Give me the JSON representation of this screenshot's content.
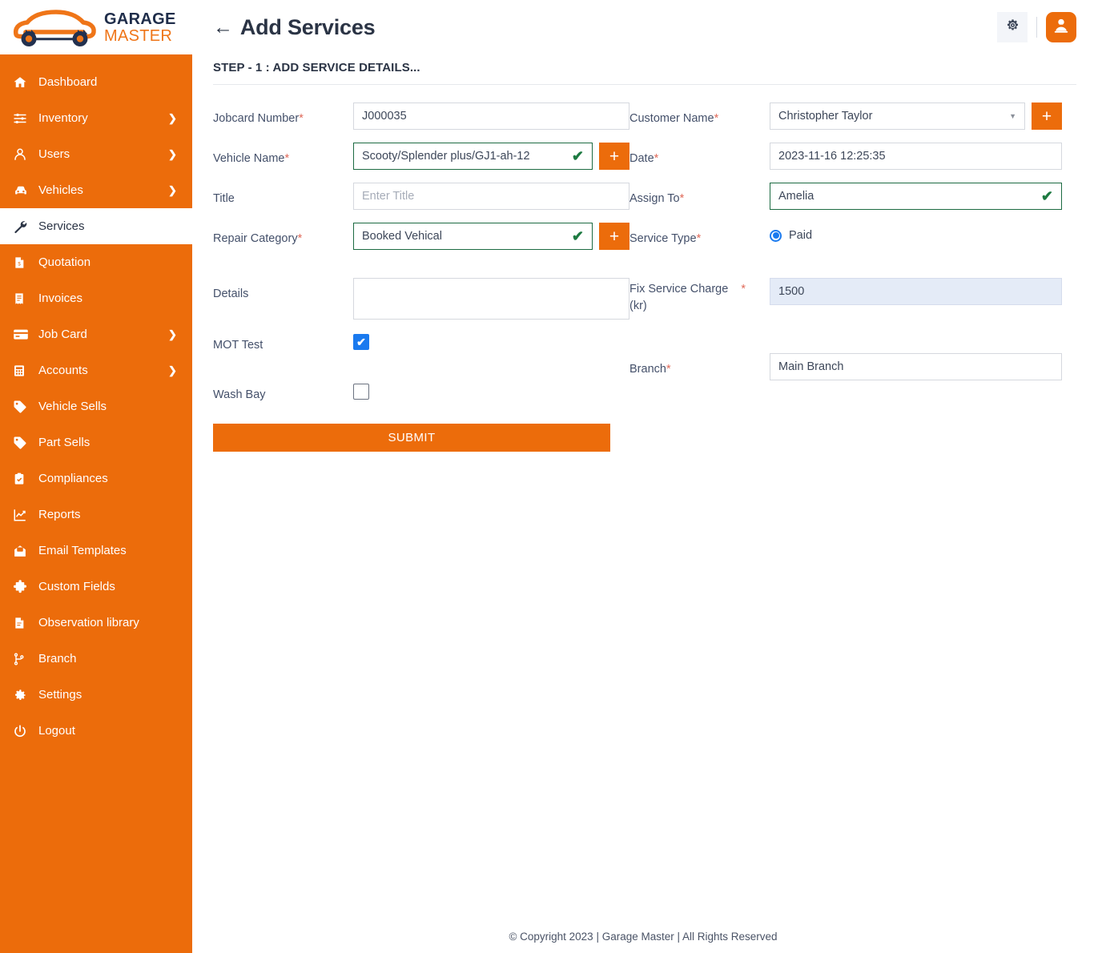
{
  "brand": {
    "logo_line1": "GARAGE",
    "logo_line2": "MASTER",
    "logo_icon": "car-wrench-logo",
    "orange": "#ec6c0b",
    "navy": "#1f2d4a"
  },
  "sidebar": {
    "items": [
      {
        "label": "Dashboard",
        "icon": "home-icon",
        "chevron": "",
        "active": false
      },
      {
        "label": "Inventory",
        "icon": "sliders-icon",
        "chevron": "❯",
        "active": false
      },
      {
        "label": "Users",
        "icon": "user-icon",
        "chevron": "❯",
        "active": false
      },
      {
        "label": "Vehicles",
        "icon": "car-icon",
        "chevron": "❯",
        "active": false
      },
      {
        "label": "Services",
        "icon": "wrench-icon",
        "chevron": "",
        "active": true
      },
      {
        "label": "Quotation",
        "icon": "quote-doc-icon",
        "chevron": "",
        "active": false
      },
      {
        "label": "Invoices",
        "icon": "invoice-icon",
        "chevron": "",
        "active": false
      },
      {
        "label": "Job Card",
        "icon": "card-icon",
        "chevron": "❯",
        "active": false
      },
      {
        "label": "Accounts",
        "icon": "calculator-icon",
        "chevron": "❯",
        "active": false
      },
      {
        "label": "Vehicle Sells",
        "icon": "tag-icon",
        "chevron": "",
        "active": false
      },
      {
        "label": "Part Sells",
        "icon": "tag-icon",
        "chevron": "",
        "active": false
      },
      {
        "label": "Compliances",
        "icon": "clipboard-check-icon",
        "chevron": "",
        "active": false
      },
      {
        "label": "Reports",
        "icon": "chart-line-icon",
        "chevron": "",
        "active": false
      },
      {
        "label": "Email Templates",
        "icon": "mail-open-icon",
        "chevron": "",
        "active": false
      },
      {
        "label": "Custom Fields",
        "icon": "puzzle-icon",
        "chevron": "",
        "active": false
      },
      {
        "label": "Observation library",
        "icon": "file-icon",
        "chevron": "",
        "active": false
      },
      {
        "label": "Branch",
        "icon": "branch-icon",
        "chevron": "",
        "active": false
      },
      {
        "label": "Settings",
        "icon": "gear-icon",
        "chevron": "",
        "active": false
      },
      {
        "label": "Logout",
        "icon": "power-icon",
        "chevron": "",
        "active": false
      }
    ]
  },
  "topbar": {
    "back_arrow": "←",
    "title": "Add Services",
    "gear_icon": "gear-icon",
    "avatar_icon": "user-avatar-icon"
  },
  "step": {
    "title": "STEP - 1 : ADD SERVICE DETAILS..."
  },
  "form": {
    "left": {
      "jobcard_number": {
        "label": "Jobcard Number",
        "required": true,
        "value": "J000035",
        "state": "normal"
      },
      "vehicle_name": {
        "label": "Vehicle Name",
        "required": true,
        "value": "Scooty/Splender plus/GJ1-ah-12",
        "state": "valid",
        "tick": "✔",
        "add_button": "+"
      },
      "title": {
        "label": "Title",
        "required": false,
        "value": "",
        "placeholder": "Enter Title",
        "state": "normal"
      },
      "repair_category": {
        "label": "Repair Category",
        "required": true,
        "value": "Booked Vehical",
        "state": "valid",
        "tick": "✔",
        "add_button": "+"
      },
      "details": {
        "label": "Details",
        "required": false,
        "value": "",
        "placeholder": ""
      },
      "mot_test": {
        "label": "MOT Test",
        "checked": true,
        "check_glyph": "✔"
      },
      "wash_bay": {
        "label": "Wash Bay",
        "checked": false,
        "check_glyph": ""
      }
    },
    "right": {
      "customer_name": {
        "label": "Customer Name",
        "required": true,
        "value": "Christopher Taylor",
        "state": "select",
        "caret": "▼",
        "add_button": "+"
      },
      "date": {
        "label": "Date",
        "required": true,
        "value": "2023-11-16  12:25:35",
        "state": "normal"
      },
      "assign_to": {
        "label": "Assign To",
        "required": true,
        "value": "Amelia",
        "state": "valid",
        "tick": "✔"
      },
      "service_type": {
        "label": "Service Type",
        "required": true,
        "selected": "Paid",
        "options": [
          "Paid"
        ]
      },
      "fix_service_charge": {
        "label_line1": "Fix Service Charge",
        "label_line2": "(kr)",
        "required": true,
        "required_mark": "*",
        "value": "1500",
        "state": "readonly-blue"
      },
      "branch": {
        "label": "Branch",
        "required": true,
        "value": "Main Branch",
        "state": "normal"
      }
    },
    "submit_label": "SUBMIT"
  },
  "footer": {
    "text": "© Copyright 2023 | Garage Master | All Rights Reserved"
  }
}
